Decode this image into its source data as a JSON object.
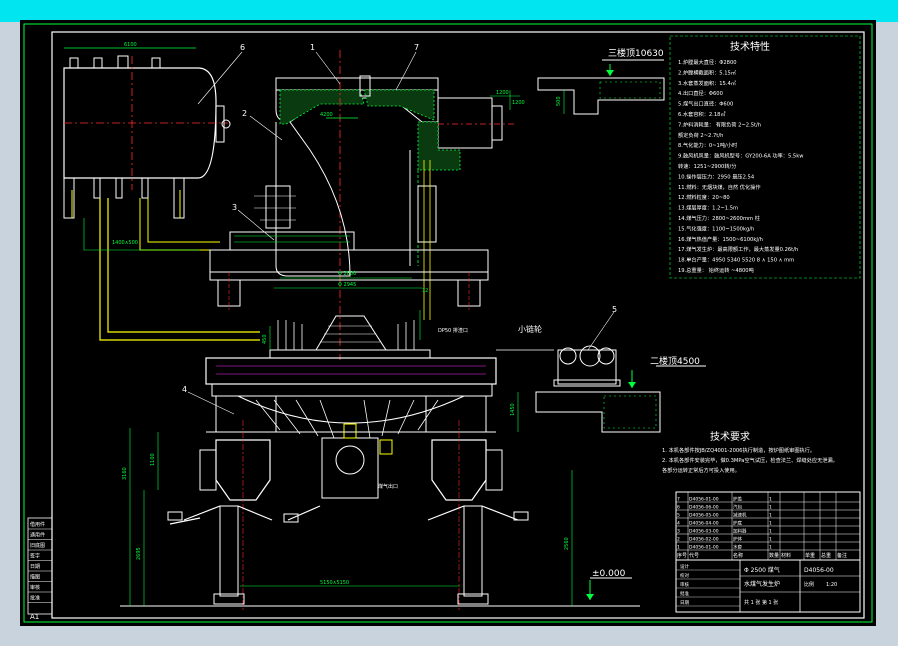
{
  "drawing": {
    "theme": {
      "background": "#000000",
      "frame_top_band": "#00e5f0",
      "outer_bg": "#c9d3dd",
      "line_green": "#00ff3c",
      "line_white": "#ffffff",
      "line_red": "#ff2a2a",
      "line_yellow": "#ffff00",
      "line_magenta": "#ff33ff",
      "line_cyan": "#00e5ff"
    },
    "labels": {
      "third_floor": "三楼顶10630",
      "second_floor": "二楼顶4500",
      "ground_level": "±0.000",
      "small_pulley": "小链轮",
      "sheet_mark": "A1",
      "callout_1": "1",
      "callout_2": "2",
      "callout_3": "3",
      "callout_4": "4",
      "callout_5": "5",
      "callout_6": "6",
      "callout_7": "7"
    },
    "dimensions": {
      "d_6100": "6100",
      "d_4200": "4200",
      "d_1200": "1200",
      "d_1200b": "1200",
      "d_500": "500",
      "d_1400": "1400∧500",
      "d_2800": "Φ 2800",
      "d_2945": "Φ 2945",
      "d_450": "450",
      "d_12": "12",
      "d_1450": "1450",
      "d_5150": "5150∧5150",
      "d_2695": "2695",
      "d_3160": "3160",
      "d_2560": "2560",
      "d_1100": "1100",
      "d_dp50": "DP50 排渣口",
      "d_gas": "煤气出口"
    },
    "tech_spec": {
      "title": "技术特性",
      "lines": [
        "1.炉膛最大直径：Φ2800",
        "2.炉膛横截面积：5.15㎡",
        "3.水套蒸发面积：15.4㎡",
        "4.出口直径：Φ600",
        "5.煤气出口直径：Φ600",
        "6.水套容积：2.18㎥",
        "7.炉料消耗量：    有限负荷  2~2.5t/h",
        "                      额定负荷  2~2.7t/h",
        "8.气化能力：0~1吨/小时",
        "9.鼓风机风量：鼓风机型号：GY200-6A  功率：5.5kw",
        "   转速：1251~2900转/分",
        "10.操作层压力：2950  最压2.54",
        "11.燃料：无烟块煤，自然  优化操作",
        "12.燃料粒度：20~80",
        "13.煤层厚度：1.2~1.5m",
        "14.煤气压力：2800~2600mm 柱",
        "15.气化强度：1100~1500kg/h",
        "16.煤气热值产量：1500~6100kJ/h",
        "17.煤气发生炉：最高限额工作，最大蒸发量0.26t/h",
        "18.单台产量：4950  5340 5520  8 ∧ 150 ∧ mm",
        "19.总重量：    始终运转 ~4800吨"
      ]
    },
    "tech_req": {
      "title": "技术要求",
      "lines": [
        "1. 本机各部件按JB/ZQ4001-2006执行制造，按炉图纸审图执行。",
        "2. 本机各部件安装完毕，做0.3MPa空气试压，检查法兰、焊缝处应无泄漏，",
        "   各部分运转正常后方可投入使用。"
      ]
    },
    "title_block": {
      "name": "Φ 2500 煤气",
      "desc": "水煤气发生炉",
      "drawing_no": "D4056-00",
      "headers": [
        "序号",
        "代号",
        "名称",
        "数量",
        "材料",
        "单重",
        "总重",
        "备注"
      ],
      "rows": [
        [
          "7",
          "D4056-01-00",
          "炉盖",
          "1",
          "",
          "",
          "",
          ""
        ],
        [
          "6",
          "D4056-06-00",
          "汽包",
          "1",
          "",
          "",
          "",
          ""
        ],
        [
          "5",
          "D4056-05-00",
          "减速机",
          "1",
          "",
          "",
          "",
          ""
        ],
        [
          "4",
          "D4056-04-00",
          "炉底",
          "1",
          "",
          "",
          "",
          ""
        ],
        [
          "3",
          "D4056-03-00",
          "加料器",
          "1",
          "",
          "",
          "",
          ""
        ],
        [
          "2",
          "D4056-02-00",
          "炉体",
          "1",
          "",
          "",
          "",
          ""
        ],
        [
          "1",
          "D4056-01-00",
          "水套",
          "1",
          "",
          "",
          "",
          ""
        ]
      ],
      "sign_rows": [
        "设计",
        "校对",
        "审核",
        "批准",
        "日期"
      ],
      "scale_label": "比例",
      "scale_value": "1:20",
      "sheet_label": "共 1 张 第 1 张"
    },
    "left_tab": {
      "rows": [
        "借用件",
        "通用件",
        "旧底图",
        "签字",
        "日期",
        "描图",
        "审核",
        "批准"
      ]
    }
  }
}
